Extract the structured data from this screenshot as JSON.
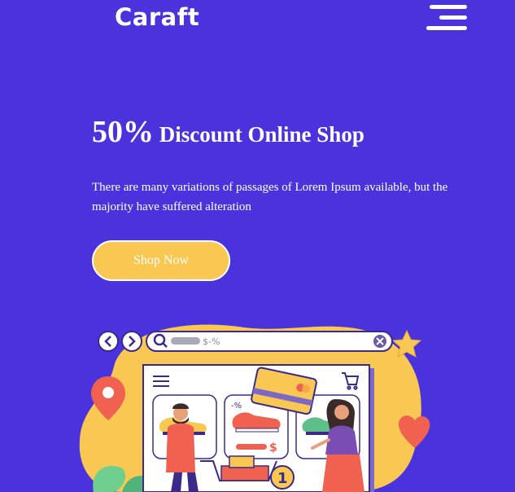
{
  "header": {
    "logo": "Caraft",
    "menu_icon": "hamburger-menu-icon"
  },
  "hero": {
    "title_highlight": "50%",
    "title_rest": " Discount Online Shop",
    "description": "There are many variations of passages of Lorem Ipsum available, but the majority have suffered alteration",
    "button_label": "Shop Now"
  },
  "illustration": {
    "search_text": "$-%",
    "discount_tag": "-%",
    "price_symbol": "$",
    "cart_count": "1",
    "icons": [
      "back-arrow-icon",
      "forward-arrow-icon",
      "search-icon",
      "close-icon",
      "star-icon",
      "map-pin-icon",
      "heart-icon",
      "cart-icon",
      "menu-lines-icon",
      "credit-card-icon"
    ]
  },
  "colors": {
    "background": "#4a33dc",
    "accent_yellow": "#f9c852",
    "text": "#ffffff"
  }
}
